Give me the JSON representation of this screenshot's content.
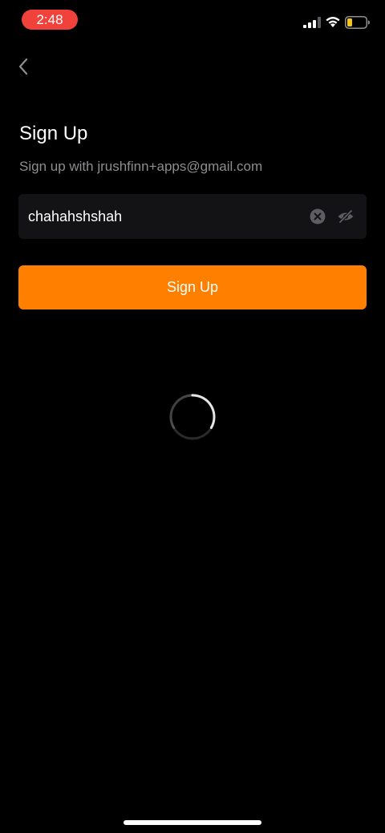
{
  "status_bar": {
    "time": "2:48",
    "signal_icon": "cellular-signal-icon",
    "wifi_icon": "wifi-icon",
    "battery_icon": "battery-low-icon",
    "time_pill_color": "#f0413b",
    "battery_color": "#f5c518"
  },
  "header": {
    "back_icon": "chevron-left-icon"
  },
  "signup": {
    "title": "Sign Up",
    "subtitle": "Sign up with jrushfinn+apps@gmail.com",
    "password_value": "chahahshshah",
    "clear_icon": "clear-circle-icon",
    "visibility_icon": "eye-off-icon",
    "button_label": "Sign Up",
    "accent_color": "#ff7f00"
  },
  "loading": {
    "spinner_icon": "loading-spinner-icon"
  }
}
